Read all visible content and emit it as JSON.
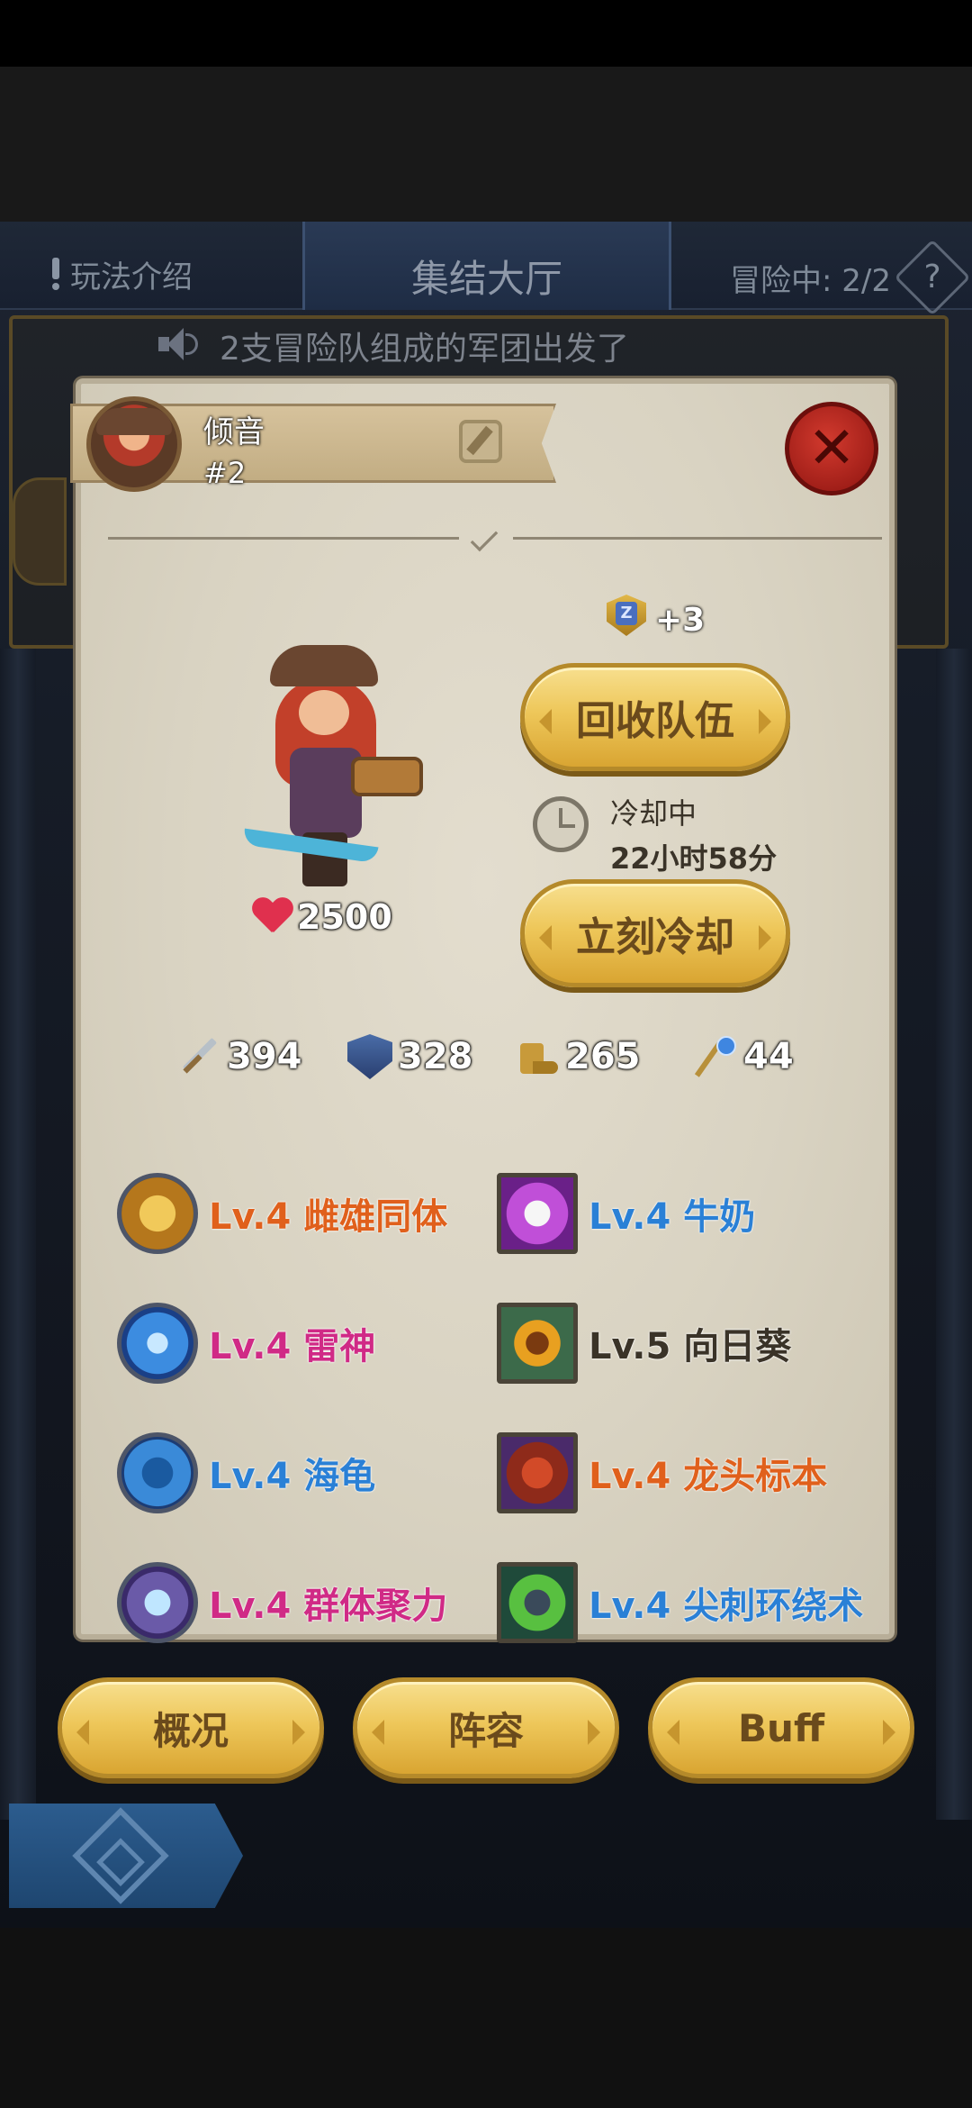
{
  "header": {
    "help_label": "玩法介绍",
    "title": "集结大厅",
    "status": "冒险中: 2/2",
    "question_mark": "?"
  },
  "announcement": "2支冒险队组成的军团出发了",
  "player": {
    "name": "倾音",
    "rank": "#2"
  },
  "close_symbol": "✕",
  "hero": {
    "hp": "2500"
  },
  "badge": {
    "letter": "Z",
    "bonus": "+3"
  },
  "actions": {
    "recall_label": "回收队伍",
    "cooldown_label": "冷却中",
    "cooldown_time": "22小时58分",
    "instant_label": "立刻冷却"
  },
  "stats": {
    "attack": "394",
    "defense": "328",
    "speed": "265",
    "magic": "44"
  },
  "skills": [
    {
      "level": "Lv.4",
      "name": "雌雄同体",
      "color": "#e0601c",
      "icon": "hermaphrodite-icon"
    },
    {
      "level": "Lv.4",
      "name": "牛奶",
      "color": "#2a80d6",
      "icon": "milk-icon"
    },
    {
      "level": "Lv.4",
      "name": "雷神",
      "color": "#d02a86",
      "icon": "thunder-god-icon"
    },
    {
      "level": "Lv.5",
      "name": "向日葵",
      "color": "#3a3328",
      "icon": "sunflower-icon"
    },
    {
      "level": "Lv.4",
      "name": "海龟",
      "color": "#2a80d6",
      "icon": "sea-turtle-icon"
    },
    {
      "level": "Lv.4",
      "name": "龙头标本",
      "color": "#e0601c",
      "icon": "dragon-head-icon"
    },
    {
      "level": "Lv.4",
      "name": "群体聚力",
      "color": "#d02a86",
      "icon": "group-power-icon"
    },
    {
      "level": "Lv.4",
      "name": "尖刺环绕术",
      "color": "#2a80d6",
      "icon": "spike-ring-icon"
    }
  ],
  "bottom_tabs": {
    "overview": "概况",
    "lineup": "阵容",
    "buff": "Buff"
  }
}
